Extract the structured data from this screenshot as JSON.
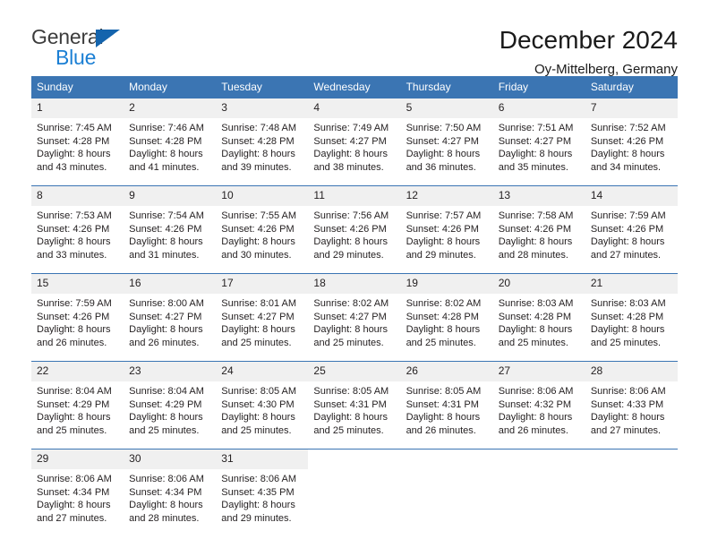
{
  "logo": {
    "primary_text": "General",
    "secondary_text": "Blue",
    "primary_color": "#3c3c3c",
    "secondary_color": "#1b7fd4",
    "triangle_color": "#1464ad"
  },
  "header": {
    "title": "December 2024",
    "subtitle": "Oy-Mittelberg, Germany"
  },
  "theme": {
    "header_blue": "#3b75b3",
    "daynum_bg": "#f0f0f0",
    "text_color": "#231f20"
  },
  "weekdays": [
    "Sunday",
    "Monday",
    "Tuesday",
    "Wednesday",
    "Thursday",
    "Friday",
    "Saturday"
  ],
  "weeks": [
    [
      {
        "day": "1",
        "sunrise": "Sunrise: 7:45 AM",
        "sunset": "Sunset: 4:28 PM",
        "daylight1": "Daylight: 8 hours",
        "daylight2": "and 43 minutes."
      },
      {
        "day": "2",
        "sunrise": "Sunrise: 7:46 AM",
        "sunset": "Sunset: 4:28 PM",
        "daylight1": "Daylight: 8 hours",
        "daylight2": "and 41 minutes."
      },
      {
        "day": "3",
        "sunrise": "Sunrise: 7:48 AM",
        "sunset": "Sunset: 4:28 PM",
        "daylight1": "Daylight: 8 hours",
        "daylight2": "and 39 minutes."
      },
      {
        "day": "4",
        "sunrise": "Sunrise: 7:49 AM",
        "sunset": "Sunset: 4:27 PM",
        "daylight1": "Daylight: 8 hours",
        "daylight2": "and 38 minutes."
      },
      {
        "day": "5",
        "sunrise": "Sunrise: 7:50 AM",
        "sunset": "Sunset: 4:27 PM",
        "daylight1": "Daylight: 8 hours",
        "daylight2": "and 36 minutes."
      },
      {
        "day": "6",
        "sunrise": "Sunrise: 7:51 AM",
        "sunset": "Sunset: 4:27 PM",
        "daylight1": "Daylight: 8 hours",
        "daylight2": "and 35 minutes."
      },
      {
        "day": "7",
        "sunrise": "Sunrise: 7:52 AM",
        "sunset": "Sunset: 4:26 PM",
        "daylight1": "Daylight: 8 hours",
        "daylight2": "and 34 minutes."
      }
    ],
    [
      {
        "day": "8",
        "sunrise": "Sunrise: 7:53 AM",
        "sunset": "Sunset: 4:26 PM",
        "daylight1": "Daylight: 8 hours",
        "daylight2": "and 33 minutes."
      },
      {
        "day": "9",
        "sunrise": "Sunrise: 7:54 AM",
        "sunset": "Sunset: 4:26 PM",
        "daylight1": "Daylight: 8 hours",
        "daylight2": "and 31 minutes."
      },
      {
        "day": "10",
        "sunrise": "Sunrise: 7:55 AM",
        "sunset": "Sunset: 4:26 PM",
        "daylight1": "Daylight: 8 hours",
        "daylight2": "and 30 minutes."
      },
      {
        "day": "11",
        "sunrise": "Sunrise: 7:56 AM",
        "sunset": "Sunset: 4:26 PM",
        "daylight1": "Daylight: 8 hours",
        "daylight2": "and 29 minutes."
      },
      {
        "day": "12",
        "sunrise": "Sunrise: 7:57 AM",
        "sunset": "Sunset: 4:26 PM",
        "daylight1": "Daylight: 8 hours",
        "daylight2": "and 29 minutes."
      },
      {
        "day": "13",
        "sunrise": "Sunrise: 7:58 AM",
        "sunset": "Sunset: 4:26 PM",
        "daylight1": "Daylight: 8 hours",
        "daylight2": "and 28 minutes."
      },
      {
        "day": "14",
        "sunrise": "Sunrise: 7:59 AM",
        "sunset": "Sunset: 4:26 PM",
        "daylight1": "Daylight: 8 hours",
        "daylight2": "and 27 minutes."
      }
    ],
    [
      {
        "day": "15",
        "sunrise": "Sunrise: 7:59 AM",
        "sunset": "Sunset: 4:26 PM",
        "daylight1": "Daylight: 8 hours",
        "daylight2": "and 26 minutes."
      },
      {
        "day": "16",
        "sunrise": "Sunrise: 8:00 AM",
        "sunset": "Sunset: 4:27 PM",
        "daylight1": "Daylight: 8 hours",
        "daylight2": "and 26 minutes."
      },
      {
        "day": "17",
        "sunrise": "Sunrise: 8:01 AM",
        "sunset": "Sunset: 4:27 PM",
        "daylight1": "Daylight: 8 hours",
        "daylight2": "and 25 minutes."
      },
      {
        "day": "18",
        "sunrise": "Sunrise: 8:02 AM",
        "sunset": "Sunset: 4:27 PM",
        "daylight1": "Daylight: 8 hours",
        "daylight2": "and 25 minutes."
      },
      {
        "day": "19",
        "sunrise": "Sunrise: 8:02 AM",
        "sunset": "Sunset: 4:28 PM",
        "daylight1": "Daylight: 8 hours",
        "daylight2": "and 25 minutes."
      },
      {
        "day": "20",
        "sunrise": "Sunrise: 8:03 AM",
        "sunset": "Sunset: 4:28 PM",
        "daylight1": "Daylight: 8 hours",
        "daylight2": "and 25 minutes."
      },
      {
        "day": "21",
        "sunrise": "Sunrise: 8:03 AM",
        "sunset": "Sunset: 4:28 PM",
        "daylight1": "Daylight: 8 hours",
        "daylight2": "and 25 minutes."
      }
    ],
    [
      {
        "day": "22",
        "sunrise": "Sunrise: 8:04 AM",
        "sunset": "Sunset: 4:29 PM",
        "daylight1": "Daylight: 8 hours",
        "daylight2": "and 25 minutes."
      },
      {
        "day": "23",
        "sunrise": "Sunrise: 8:04 AM",
        "sunset": "Sunset: 4:29 PM",
        "daylight1": "Daylight: 8 hours",
        "daylight2": "and 25 minutes."
      },
      {
        "day": "24",
        "sunrise": "Sunrise: 8:05 AM",
        "sunset": "Sunset: 4:30 PM",
        "daylight1": "Daylight: 8 hours",
        "daylight2": "and 25 minutes."
      },
      {
        "day": "25",
        "sunrise": "Sunrise: 8:05 AM",
        "sunset": "Sunset: 4:31 PM",
        "daylight1": "Daylight: 8 hours",
        "daylight2": "and 25 minutes."
      },
      {
        "day": "26",
        "sunrise": "Sunrise: 8:05 AM",
        "sunset": "Sunset: 4:31 PM",
        "daylight1": "Daylight: 8 hours",
        "daylight2": "and 26 minutes."
      },
      {
        "day": "27",
        "sunrise": "Sunrise: 8:06 AM",
        "sunset": "Sunset: 4:32 PM",
        "daylight1": "Daylight: 8 hours",
        "daylight2": "and 26 minutes."
      },
      {
        "day": "28",
        "sunrise": "Sunrise: 8:06 AM",
        "sunset": "Sunset: 4:33 PM",
        "daylight1": "Daylight: 8 hours",
        "daylight2": "and 27 minutes."
      }
    ],
    [
      {
        "day": "29",
        "sunrise": "Sunrise: 8:06 AM",
        "sunset": "Sunset: 4:34 PM",
        "daylight1": "Daylight: 8 hours",
        "daylight2": "and 27 minutes."
      },
      {
        "day": "30",
        "sunrise": "Sunrise: 8:06 AM",
        "sunset": "Sunset: 4:34 PM",
        "daylight1": "Daylight: 8 hours",
        "daylight2": "and 28 minutes."
      },
      {
        "day": "31",
        "sunrise": "Sunrise: 8:06 AM",
        "sunset": "Sunset: 4:35 PM",
        "daylight1": "Daylight: 8 hours",
        "daylight2": "and 29 minutes."
      },
      {
        "day": "",
        "sunrise": "",
        "sunset": "",
        "daylight1": "",
        "daylight2": ""
      },
      {
        "day": "",
        "sunrise": "",
        "sunset": "",
        "daylight1": "",
        "daylight2": ""
      },
      {
        "day": "",
        "sunrise": "",
        "sunset": "",
        "daylight1": "",
        "daylight2": ""
      },
      {
        "day": "",
        "sunrise": "",
        "sunset": "",
        "daylight1": "",
        "daylight2": ""
      }
    ]
  ]
}
